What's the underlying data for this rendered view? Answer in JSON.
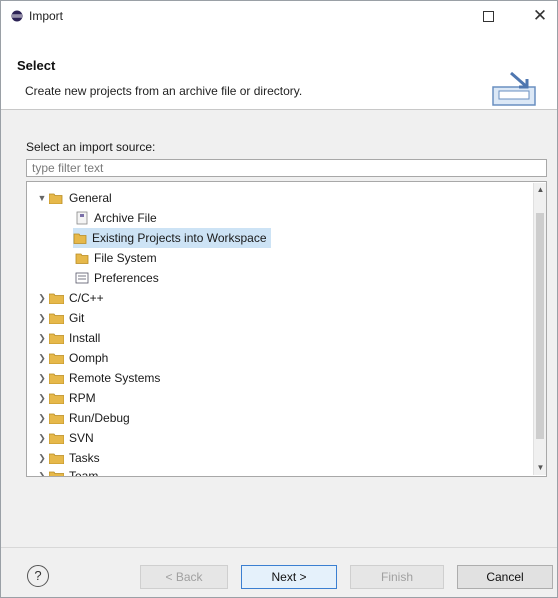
{
  "window": {
    "title": "Import"
  },
  "banner": {
    "title": "Select",
    "description": "Create new projects from an archive file or directory."
  },
  "source_label": "Select an import source:",
  "filter": {
    "placeholder": "type filter text",
    "value": ""
  },
  "tree": [
    {
      "label": "General",
      "expanded": true
    },
    {
      "label": "Archive File"
    },
    {
      "label": "Existing Projects into Workspace",
      "selected": true
    },
    {
      "label": "File System"
    },
    {
      "label": "Preferences"
    },
    {
      "label": "C/C++"
    },
    {
      "label": "Git"
    },
    {
      "label": "Install"
    },
    {
      "label": "Oomph"
    },
    {
      "label": "Remote Systems"
    },
    {
      "label": "RPM"
    },
    {
      "label": "Run/Debug"
    },
    {
      "label": "SVN"
    },
    {
      "label": "Tasks"
    },
    {
      "label": "Team"
    }
  ],
  "buttons": {
    "help": "?",
    "back": "< Back",
    "next": "Next >",
    "finish": "Finish",
    "cancel": "Cancel"
  },
  "colors": {
    "selection": "#cde3f5",
    "folder": "#e6b84a",
    "default_button_border": "#3b7fd1"
  }
}
